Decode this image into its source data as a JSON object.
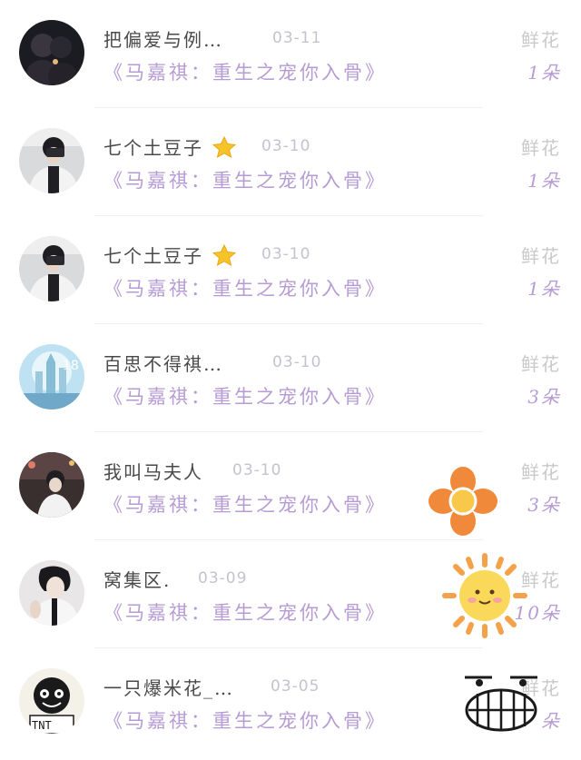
{
  "items": [
    {
      "name": "把偏爱与例…",
      "date": "03-11",
      "title": "《马嘉祺：重生之宠你入骨》",
      "gift": "鲜花",
      "count": "1朵",
      "avatar_icon": "couple-photo-avatar"
    },
    {
      "name": "七个土豆子",
      "date": "03-10",
      "title": "《马嘉祺：重生之宠你入骨》",
      "gift": "鲜花",
      "count": "1朵",
      "avatar_icon": "mirror-selfie-avatar"
    },
    {
      "name": "七个土豆子",
      "date": "03-10",
      "title": "《马嘉祺：重生之宠你入骨》",
      "gift": "鲜花",
      "count": "1朵",
      "avatar_icon": "mirror-selfie-avatar"
    },
    {
      "name": "百思不得祺…",
      "date": "03-10",
      "title": "《马嘉祺：重生之宠你入骨》",
      "gift": "鲜花",
      "count": "3朵",
      "avatar_icon": "blue-castle-avatar"
    },
    {
      "name": "我叫马夫人",
      "date": "03-10",
      "title": "《马嘉祺：重生之宠你入骨》",
      "gift": "鲜花",
      "count": "3朵",
      "avatar_icon": "street-photo-avatar"
    },
    {
      "name": "窝集区.",
      "date": "03-09",
      "title": "《马嘉祺：重生之宠你入骨》",
      "gift": "鲜花",
      "count": "10朵",
      "avatar_icon": "dark-hair-portrait-avatar"
    },
    {
      "name": "一只爆米花_…",
      "date": "03-05",
      "title": "《马嘉祺：重生之宠你入骨》",
      "gift": "鲜花",
      "count": "朵",
      "avatar_icon": "cartoon-tnt-avatar"
    }
  ],
  "colors": {
    "accent": "#b69bd4",
    "name": "#4a4a4a",
    "muted": "#c3c3cf",
    "gift": "#c9c9c9"
  },
  "stickers": [
    "orange-flower-sticker",
    "sun-sticker",
    "grin-face-sticker"
  ]
}
